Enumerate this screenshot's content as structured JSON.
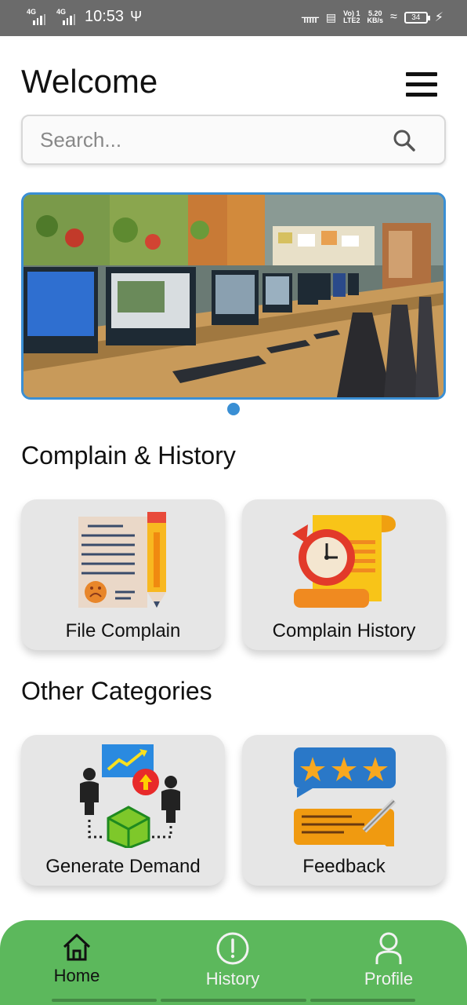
{
  "status_bar": {
    "signal1": "4G",
    "signal2": "4G",
    "time": "10:53",
    "volte_top": "Vo) 1",
    "volte_bottom": "LTE2",
    "speed_top": "5.20",
    "speed_bottom": "KB/s",
    "battery": "34"
  },
  "header": {
    "title": "Welcome"
  },
  "search": {
    "placeholder": "Search..."
  },
  "sections": {
    "complain": "Complain & History",
    "other": "Other Categories"
  },
  "cards": {
    "file_complain": "File Complain",
    "complain_history": "Complain History",
    "generate_demand": "Generate Demand",
    "feedback": "Feedback"
  },
  "bottom_nav": {
    "home": "Home",
    "history": "History",
    "profile": "Profile"
  },
  "colors": {
    "accent": "#3a8fd4",
    "nav_bg": "#5cb85c",
    "card_bg": "#e6e6e6",
    "status_bar": "#6b6b6b"
  }
}
